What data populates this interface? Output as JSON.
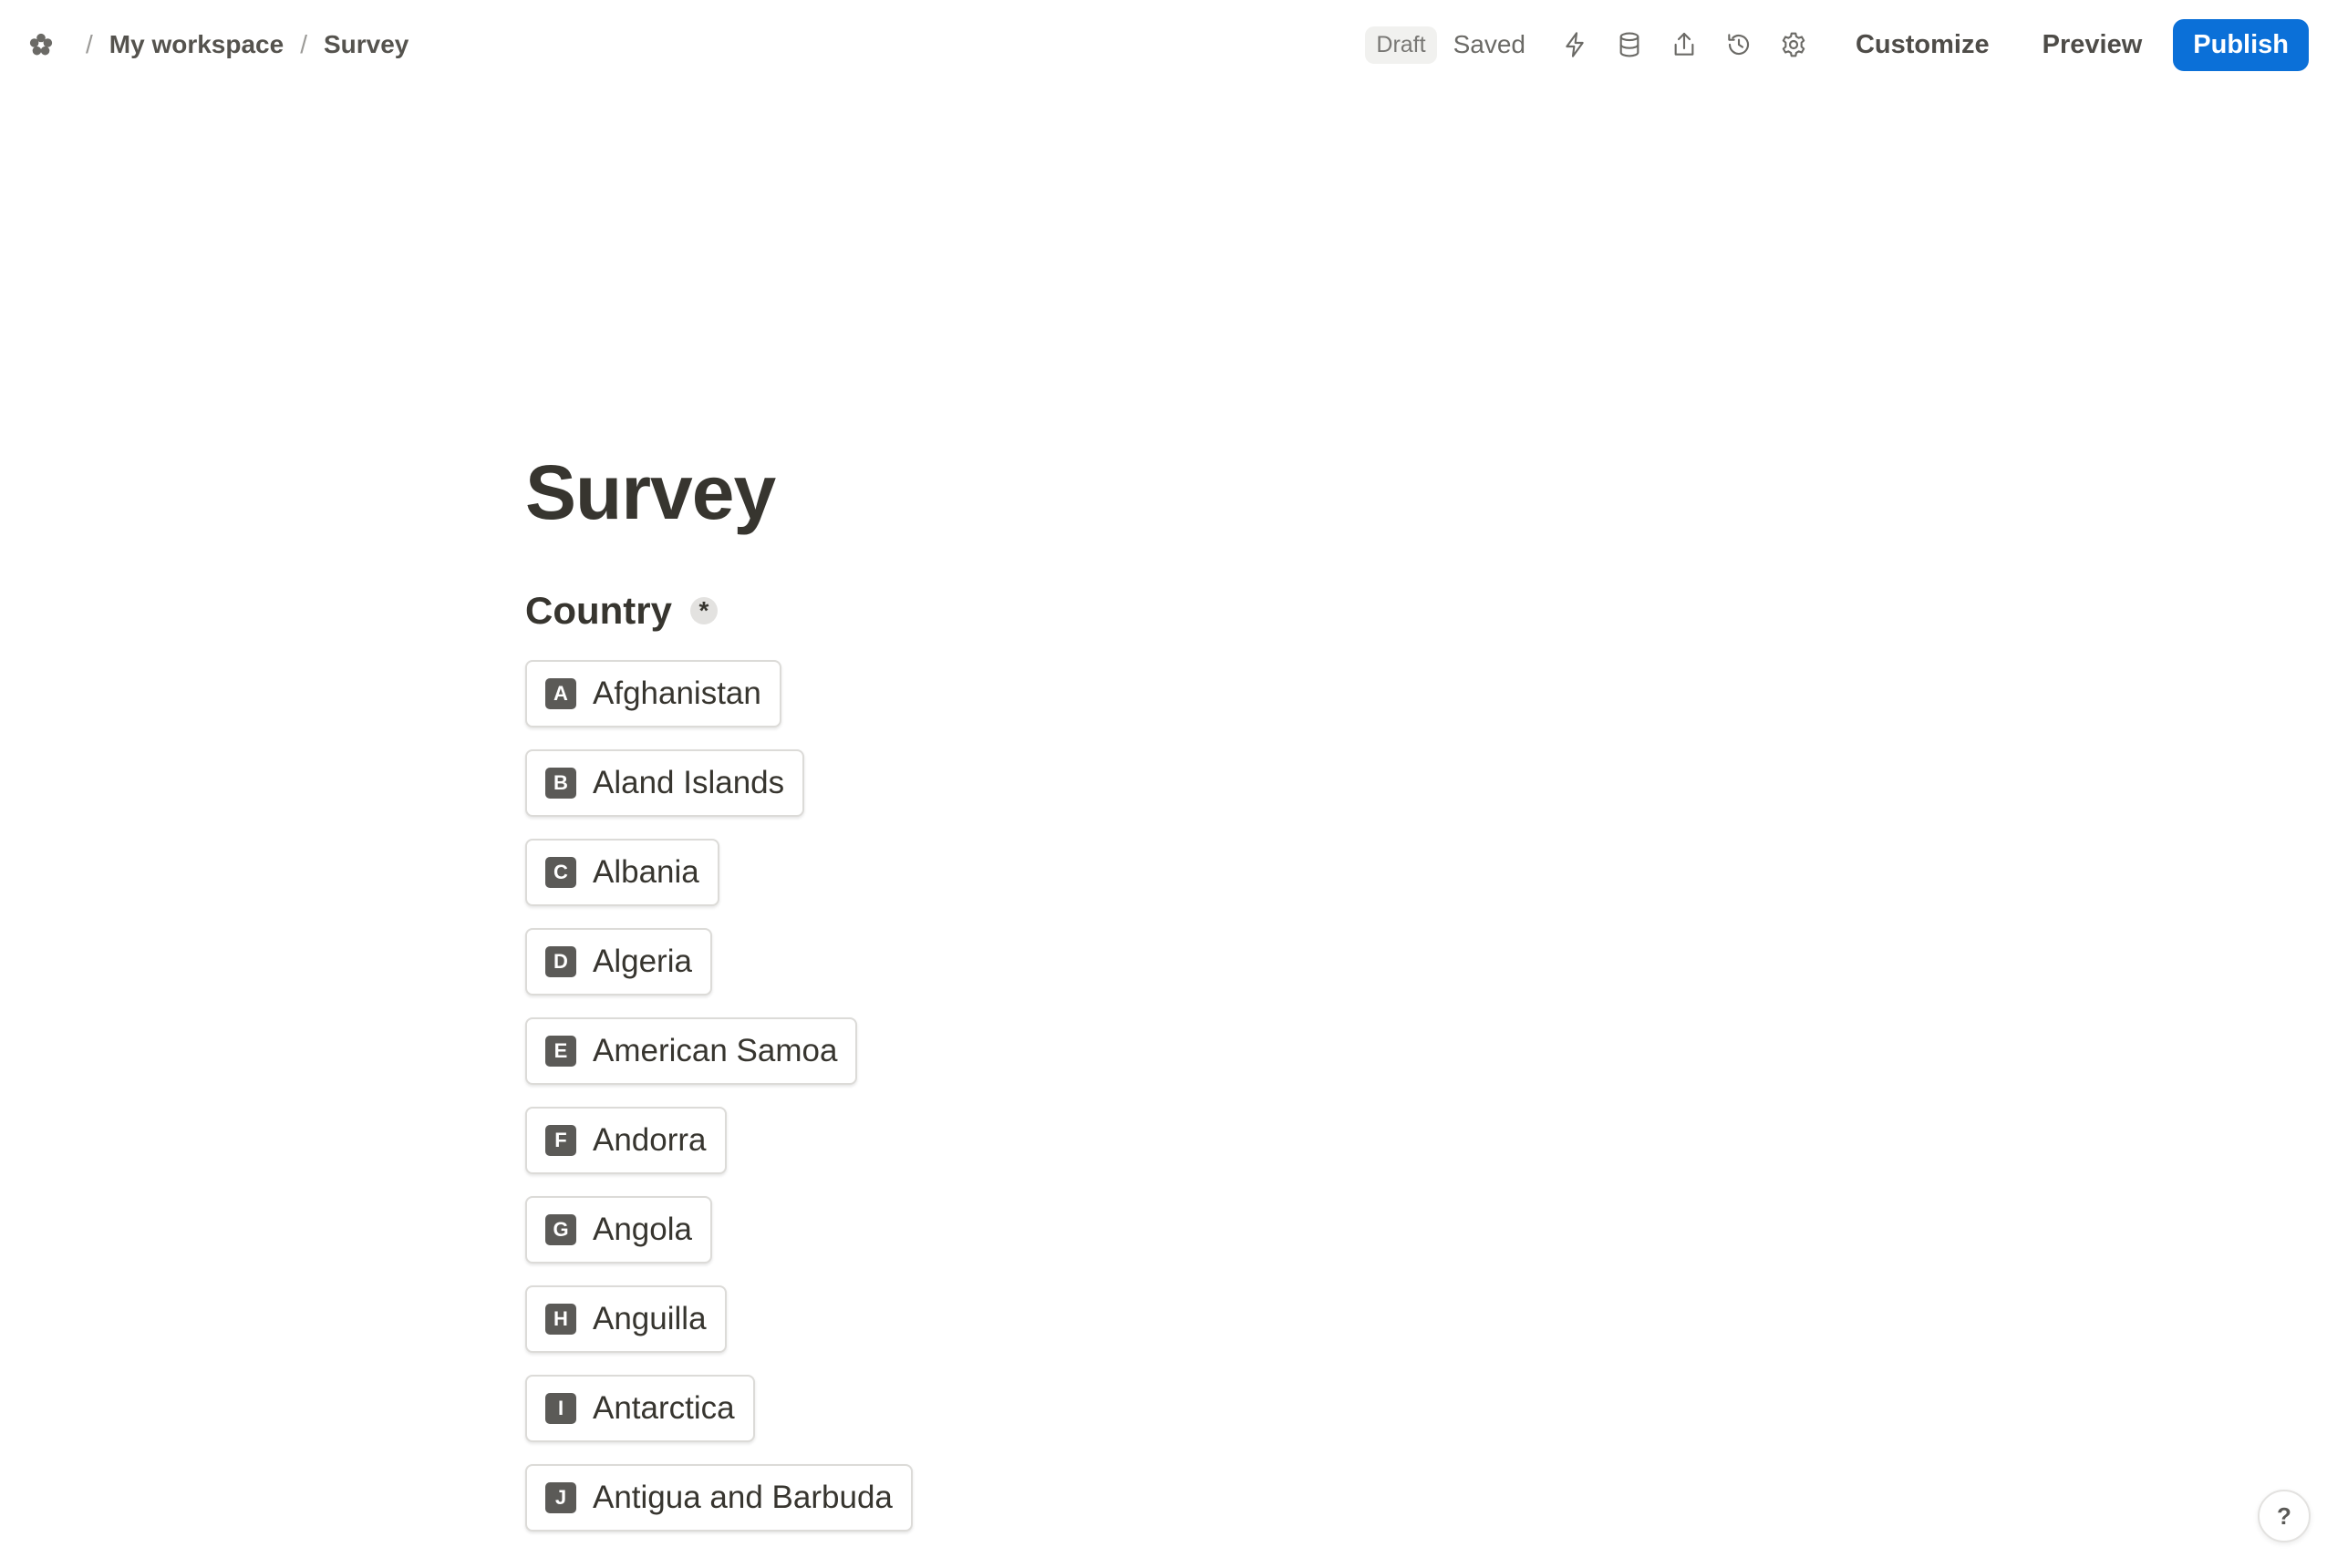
{
  "header": {
    "logo_icon": "flower-logo-icon",
    "breadcrumb": [
      "My workspace",
      "Survey"
    ],
    "separator": "/",
    "draft_label": "Draft",
    "saved_label": "Saved",
    "tools": [
      "lightning-icon",
      "database-icon",
      "share-icon",
      "history-icon",
      "gear-icon"
    ],
    "customize_label": "Customize",
    "preview_label": "Preview",
    "publish_label": "Publish",
    "accent_color": "#0b70d8"
  },
  "form": {
    "title": "Survey",
    "question": {
      "label": "Country",
      "required_mark": "*",
      "options": [
        {
          "key": "A",
          "label": "Afghanistan"
        },
        {
          "key": "B",
          "label": "Aland Islands"
        },
        {
          "key": "C",
          "label": "Albania"
        },
        {
          "key": "D",
          "label": "Algeria"
        },
        {
          "key": "E",
          "label": "American Samoa"
        },
        {
          "key": "F",
          "label": "Andorra"
        },
        {
          "key": "G",
          "label": "Angola"
        },
        {
          "key": "H",
          "label": "Anguilla"
        },
        {
          "key": "I",
          "label": "Antarctica"
        },
        {
          "key": "J",
          "label": "Antigua and Barbuda"
        }
      ]
    }
  },
  "help": {
    "label": "?"
  }
}
